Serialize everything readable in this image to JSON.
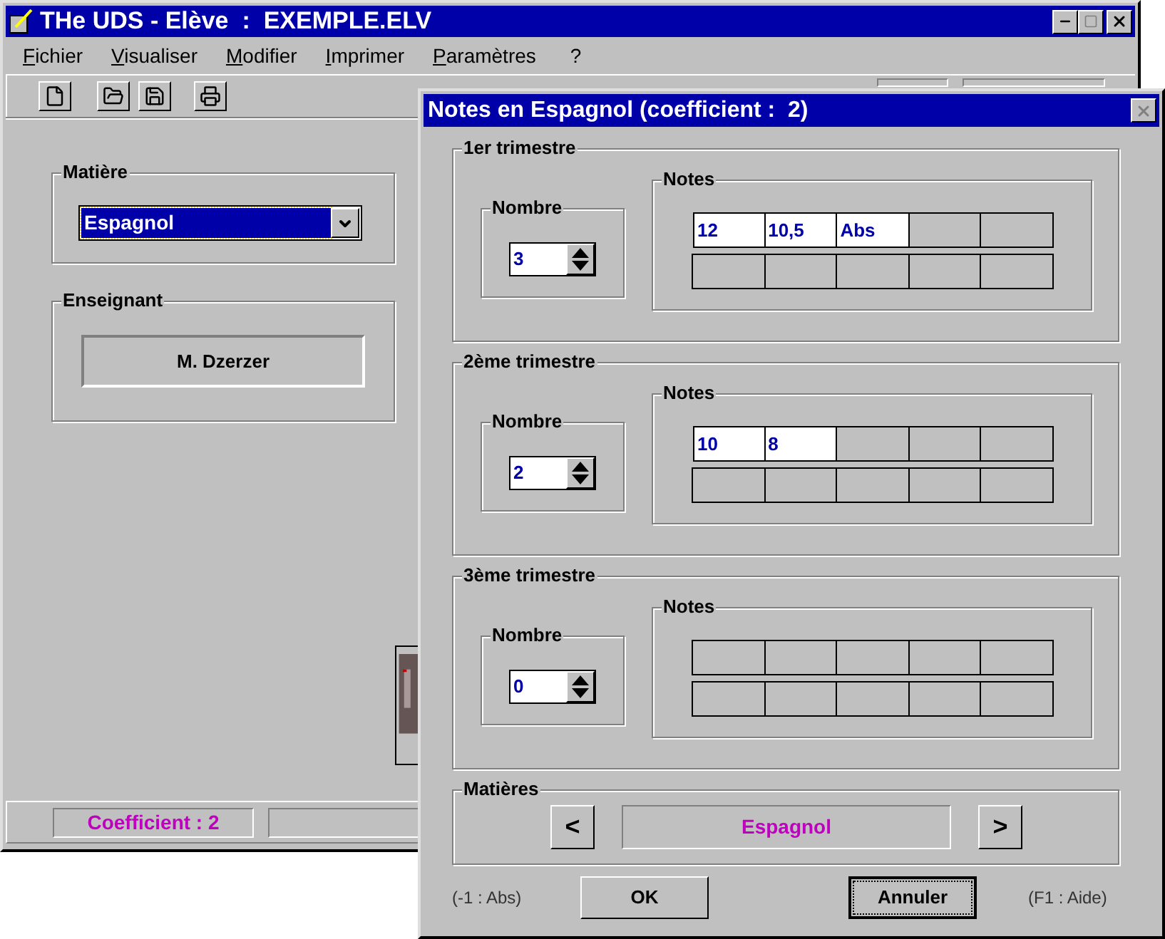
{
  "main_window": {
    "title": "THe UDS - Elève  :  EXEMPLE.ELV"
  },
  "menu": [
    {
      "label": "Fichier",
      "underlined_first": true
    },
    {
      "label": "Visualiser",
      "underlined_first": true
    },
    {
      "label": "Modifier",
      "underlined_first": true
    },
    {
      "label": "Imprimer",
      "underlined_first": true
    },
    {
      "label": "Paramètres",
      "underlined_first": true
    },
    {
      "label": "?",
      "underlined_first": false
    }
  ],
  "matiere": {
    "label": "Matière",
    "value": "Espagnol"
  },
  "enseignant": {
    "label": "Enseignant",
    "value": "M. Dzerzer"
  },
  "status_bar": {
    "coefficient": "Coefficient : 2"
  },
  "dialog": {
    "title": "Notes en Espagnol (coefficient :  2)",
    "trimesters": [
      {
        "label": "1er trimestre",
        "count_label": "Nombre",
        "count": "3",
        "notes_label": "Notes",
        "notes": [
          "12",
          "10,5",
          "Abs"
        ]
      },
      {
        "label": "2ème trimestre",
        "count_label": "Nombre",
        "count": "2",
        "notes_label": "Notes",
        "notes": [
          "10",
          "8"
        ]
      },
      {
        "label": "3ème trimestre",
        "count_label": "Nombre",
        "count": "0",
        "notes_label": "Notes"
      }
    ],
    "subjects": {
      "label": "Matières",
      "prev": "<",
      "current": "Espagnol",
      "next": ">"
    },
    "hint_left": "(-1 : Abs)",
    "ok": "OK",
    "cancel": "Annuler",
    "hint_right": "(F1 : Aide)"
  }
}
